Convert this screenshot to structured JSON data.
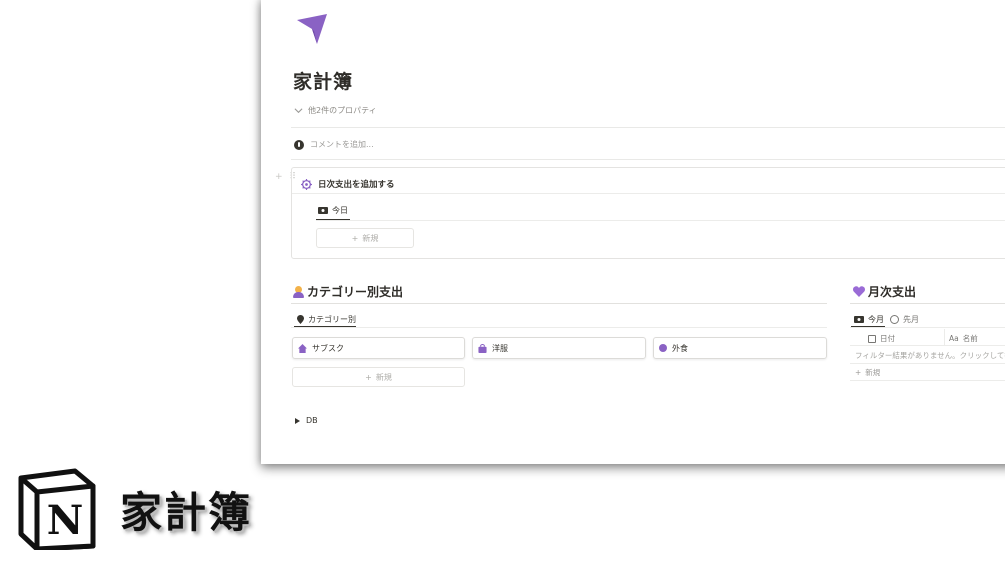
{
  "page": {
    "icon": "paper-plane-icon",
    "title": "家計簿",
    "props_toggle": "他2件のプロパティ",
    "comment_placeholder": "コメントを追加..."
  },
  "daily_widget": {
    "title": "日次支出を追加する",
    "tab": "今日",
    "new_label": "新規"
  },
  "category_section": {
    "heading": "カテゴリー別支出",
    "tab": "カテゴリー別",
    "cards": [
      {
        "label": "サブスク",
        "icon": "house-icon"
      },
      {
        "label": "洋服",
        "icon": "bag-icon"
      },
      {
        "label": "外食",
        "icon": "circle-icon"
      }
    ],
    "new_label": "新規"
  },
  "monthly_section": {
    "heading": "月次支出",
    "tab_active": "今月",
    "tab_other": "先月",
    "col_date": "日付",
    "col_name": "名前",
    "col_name_prefix": "Aa",
    "empty_text": "フィルター結果がありません。クリックして行",
    "new_label": "新規"
  },
  "db_toggle": "DB",
  "brand": {
    "text": "家計簿",
    "logo": "notion-logo"
  },
  "colors": {
    "accent_purple": "#8a62c4",
    "text": "#37352f",
    "muted": "#9b9a97"
  }
}
